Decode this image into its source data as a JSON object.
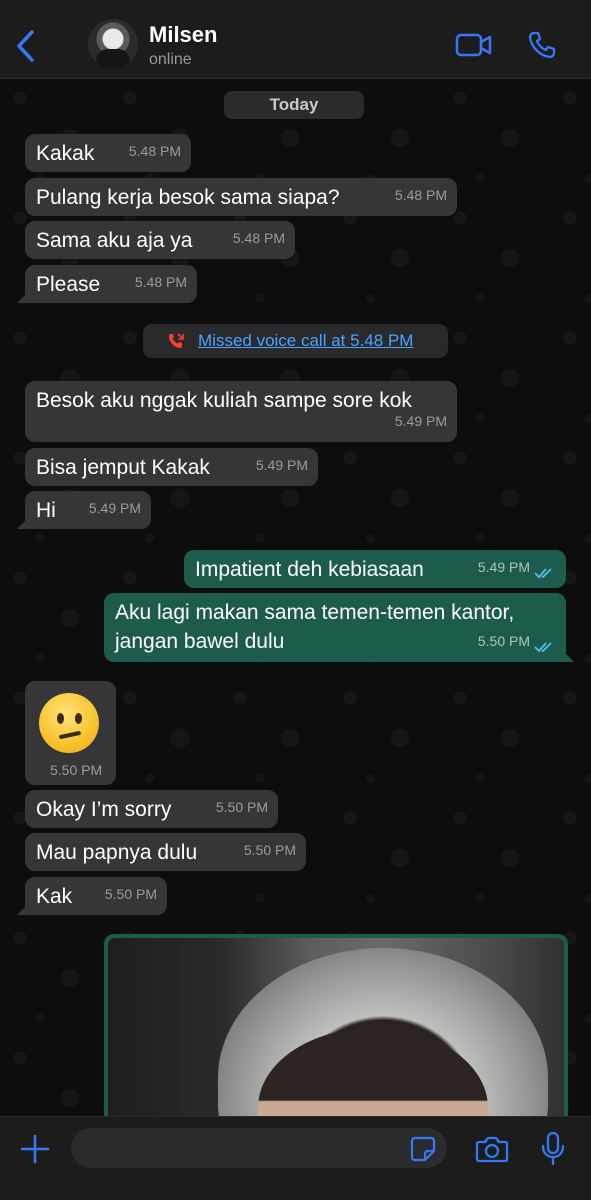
{
  "header": {
    "back_label": "Back",
    "contact_name": "Milsen",
    "status": "online",
    "icons": [
      "chevron-left-icon",
      "video-icon",
      "phone-icon"
    ],
    "accent_color": "#3478f6"
  },
  "chat": {
    "date_separator": "Today",
    "messages": [
      {
        "dir": "in",
        "text": "Kakak",
        "time": "5.48 PM"
      },
      {
        "dir": "in",
        "text": "Pulang kerja besok sama siapa?",
        "time": "5.48 PM"
      },
      {
        "dir": "in",
        "text": "Sama aku aja ya",
        "time": "5.48 PM"
      },
      {
        "dir": "in",
        "text": "Please",
        "time": "5.48 PM"
      },
      {
        "dir": "system",
        "text": "Missed voice call at 5.48 PM"
      },
      {
        "dir": "in",
        "text": "Besok aku nggak kuliah sampe sore kok",
        "time": "5.49 PM"
      },
      {
        "dir": "in",
        "text": "Bisa jemput Kakak",
        "time": "5.49 PM"
      },
      {
        "dir": "in",
        "text": "Hi",
        "time": "5.49 PM"
      },
      {
        "dir": "out",
        "text": "Impatient deh kebiasaan",
        "time": "5.49 PM",
        "status": "read"
      },
      {
        "dir": "out",
        "text": "Aku lagi makan sama temen-temen kantor, jangan bawel dulu",
        "time": "5.50 PM",
        "status": "read"
      },
      {
        "dir": "in",
        "emoji": "confused-face",
        "time": "5.50 PM"
      },
      {
        "dir": "in",
        "text": "Okay I’m sorry",
        "time": "5.50 PM"
      },
      {
        "dir": "in",
        "text": "Mau papnya dulu",
        "time": "5.50 PM"
      },
      {
        "dir": "in",
        "text": "Kak",
        "time": "5.50 PM"
      },
      {
        "dir": "out",
        "photo": "person-in-grey-hoodie"
      }
    ],
    "colors": {
      "incoming": "#363638",
      "outgoing": "#1d5b4c",
      "link": "#4aa3ff",
      "missed": "#ff3b30"
    }
  },
  "composer": {
    "placeholder": "",
    "value": "",
    "icons": [
      "plus-icon",
      "sticker-icon",
      "camera-icon",
      "microphone-icon"
    ]
  }
}
